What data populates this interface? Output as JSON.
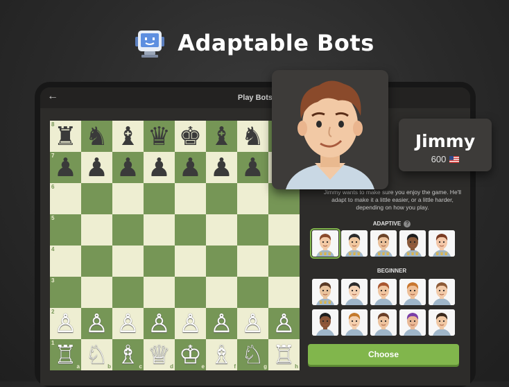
{
  "headline": {
    "title": "Adaptable Bots",
    "icon": "robot-icon"
  },
  "app": {
    "topbar_title": "Play Bots",
    "back_icon": "back-arrow-icon"
  },
  "bot": {
    "name": "Jimmy",
    "rating": "600",
    "flag_icon": "us-flag-icon",
    "description": "Jimmy wants to make sure you enjoy the game. He'll adapt to make it a little easier, or a little harder, depending on how you play."
  },
  "sections": {
    "adaptive_label": "ADAPTIVE",
    "adaptive_help_icon": "help-icon",
    "beginner_label": "BEGINNER"
  },
  "choose_button": "Choose",
  "colors": {
    "accent_green": "#81b64c",
    "board_light": "#eeeed2",
    "board_dark": "#769656",
    "crown": "#f3b51b"
  },
  "board": {
    "ranks": [
      "8",
      "7",
      "6",
      "5",
      "4",
      "3",
      "2",
      "1"
    ],
    "files": [
      "a",
      "b",
      "c",
      "d",
      "e",
      "f",
      "g",
      "h"
    ],
    "rows": [
      [
        "♜",
        "♞",
        "♝",
        "♛",
        "♚",
        "♝",
        "♞",
        ""
      ],
      [
        "♟",
        "♟",
        "♟",
        "♟",
        "♟",
        "♟",
        "♟",
        ""
      ],
      [
        "",
        "",
        "",
        "",
        "",
        "",
        "",
        ""
      ],
      [
        "",
        "",
        "",
        "",
        "",
        "",
        "",
        ""
      ],
      [
        "",
        "",
        "",
        "",
        "",
        "",
        "",
        ""
      ],
      [
        "",
        "",
        "",
        "",
        "",
        "",
        "",
        ""
      ],
      [
        "♙",
        "♙",
        "♙",
        "♙",
        "♙",
        "♙",
        "♙",
        "♙"
      ],
      [
        "♖",
        "♘",
        "♗",
        "♕",
        "♔",
        "♗",
        "♘",
        "♖"
      ]
    ]
  },
  "adaptive_bots": [
    {
      "skin": "#f2c9a5",
      "hair": "#8a4a2b",
      "crowns": "♛♛♛",
      "selected": true
    },
    {
      "skin": "#f0c8a0",
      "hair": "#2b2b2b",
      "crowns": "♛♛♛",
      "selected": false
    },
    {
      "skin": "#eac09a",
      "hair": "#6b4429",
      "crowns": "♛♛♛",
      "selected": false
    },
    {
      "skin": "#8a5a3b",
      "hair": "#1d1d1d",
      "crowns": "♛♛♛",
      "selected": false
    },
    {
      "skin": "#f3c7a8",
      "hair": "#7a3b22",
      "crowns": "♛♛♛",
      "selected": false
    }
  ],
  "beginner_bots": [
    {
      "skin": "#e9c39d",
      "hair": "#5a3a26",
      "crowns": "♛♛♛"
    },
    {
      "skin": "#f4d2b4",
      "hair": "#2b2b2b",
      "crowns": ""
    },
    {
      "skin": "#f0c6a1",
      "hair": "#a8562f",
      "crowns": ""
    },
    {
      "skin": "#eebf98",
      "hair": "#c8762f",
      "crowns": ""
    },
    {
      "skin": "#f2cbaa",
      "hair": "#8c5a36",
      "crowns": ""
    },
    {
      "skin": "#8a5538",
      "hair": "#1f1f1f",
      "crowns": ""
    },
    {
      "skin": "#f3cfae",
      "hair": "#c47a2c",
      "crowns": ""
    },
    {
      "skin": "#edc39e",
      "hair": "#6a3f27",
      "crowns": ""
    },
    {
      "skin": "#e9b996",
      "hair": "#7a3fa8",
      "crowns": ""
    },
    {
      "skin": "#f0c8a4",
      "hair": "#3b2a1e",
      "crowns": ""
    }
  ]
}
